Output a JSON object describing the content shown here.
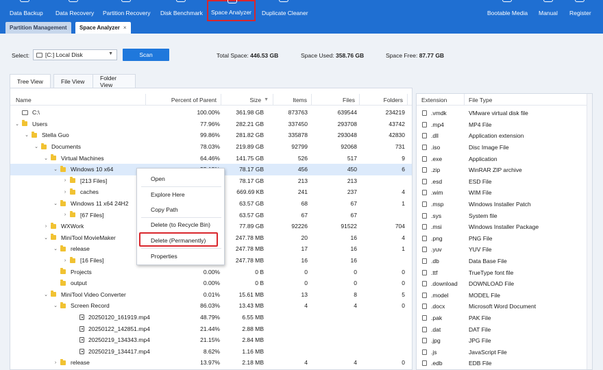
{
  "toolbar": {
    "items": [
      {
        "label": "Data Backup",
        "icon": "backup-icon"
      },
      {
        "label": "Data Recovery",
        "icon": "recovery-icon"
      },
      {
        "label": "Partition Recovery",
        "icon": "partition-recovery-icon"
      },
      {
        "label": "Disk Benchmark",
        "icon": "benchmark-icon"
      },
      {
        "label": "Space Analyzer",
        "icon": "space-analyzer-icon"
      },
      {
        "label": "Duplicate Cleaner",
        "icon": "duplicate-icon"
      },
      {
        "label": "Bootable Media",
        "icon": "bootable-icon"
      },
      {
        "label": "Manual",
        "icon": "manual-icon"
      },
      {
        "label": "Register",
        "icon": "register-icon"
      }
    ],
    "active_item": "Space Analyzer"
  },
  "tabs": [
    {
      "label": "Partition Management"
    },
    {
      "label": "Space Analyzer",
      "close": "×"
    }
  ],
  "controls": {
    "select_label": "Select:",
    "drive_value": "[C:] Local Disk",
    "scan_label": "Scan",
    "total_label": "Total Space:",
    "total_value": "446.53 GB",
    "used_label": "Space Used:",
    "used_value": "358.76 GB",
    "free_label": "Space Free:",
    "free_value": "87.77 GB"
  },
  "view_tabs": [
    "Tree View",
    "File View",
    "Folder View"
  ],
  "tree": {
    "columns": [
      "Name",
      "Percent of Parent",
      "Size",
      "Items",
      "Files",
      "Folders"
    ],
    "rows": [
      {
        "expander": "",
        "icon": "drive",
        "name": "C:\\",
        "pct": "100.00%",
        "size": "361.98 GB",
        "items": "873763",
        "files": "639544",
        "folders": "234219"
      },
      {
        "expander": "⌄",
        "icon": "folder",
        "name": "Users",
        "pct": "77.96%",
        "size": "282.21 GB",
        "items": "337450",
        "files": "293708",
        "folders": "43742"
      },
      {
        "expander": "⌄",
        "icon": "folder",
        "name": "Stella Guo",
        "pct": "99.86%",
        "size": "281.82 GB",
        "items": "335878",
        "files": "293048",
        "folders": "42830"
      },
      {
        "expander": "⌄",
        "icon": "folder",
        "name": "Documents",
        "pct": "78.03%",
        "size": "219.89 GB",
        "items": "92799",
        "files": "92068",
        "folders": "731"
      },
      {
        "expander": "⌄",
        "icon": "folder",
        "name": "Virtual Machines",
        "pct": "64.46%",
        "size": "141.75 GB",
        "items": "526",
        "files": "517",
        "folders": "9"
      },
      {
        "expander": "⌄",
        "icon": "folder",
        "name": "Windows 10 x64",
        "pct": "55.15%",
        "size": "78.17 GB",
        "items": "456",
        "files": "450",
        "folders": "6"
      },
      {
        "expander": "›",
        "icon": "folder",
        "name": "[213 Files]",
        "pct": "",
        "size": "78.17 GB",
        "items": "213",
        "files": "213",
        "folders": ""
      },
      {
        "expander": "›",
        "icon": "folder",
        "name": "caches",
        "pct": "",
        "size": "669.69 KB",
        "items": "241",
        "files": "237",
        "folders": "4"
      },
      {
        "expander": "⌄",
        "icon": "folder",
        "name": "Windows 11 x64 24H2",
        "pct": "",
        "size": "63.57 GB",
        "items": "68",
        "files": "67",
        "folders": "1"
      },
      {
        "expander": "›",
        "icon": "folder",
        "name": "[67 Files]",
        "pct": "",
        "size": "63.57 GB",
        "items": "67",
        "files": "67",
        "folders": ""
      },
      {
        "expander": "›",
        "icon": "folder",
        "name": "WXWork",
        "pct": "",
        "size": "77.89 GB",
        "items": "92226",
        "files": "91522",
        "folders": "704"
      },
      {
        "expander": "⌄",
        "icon": "folder",
        "name": "MiniTool MovieMaker",
        "pct": "",
        "size": "247.78 MB",
        "items": "20",
        "files": "16",
        "folders": "4"
      },
      {
        "expander": "⌄",
        "icon": "folder",
        "name": "release",
        "pct": "",
        "size": "247.78 MB",
        "items": "17",
        "files": "16",
        "folders": "1"
      },
      {
        "expander": "›",
        "icon": "folder",
        "name": "[16 Files]",
        "pct": "",
        "size": "247.78 MB",
        "items": "16",
        "files": "16",
        "folders": ""
      },
      {
        "expander": "",
        "icon": "folder",
        "name": "Projects",
        "pct": "0.00%",
        "size": "0 B",
        "items": "0",
        "files": "0",
        "folders": "0"
      },
      {
        "expander": "",
        "icon": "folder",
        "name": "output",
        "pct": "0.00%",
        "size": "0 B",
        "items": "0",
        "files": "0",
        "folders": "0"
      },
      {
        "expander": "⌄",
        "icon": "folder",
        "name": "MiniTool Video Converter",
        "pct": "0.01%",
        "size": "15.61 MB",
        "items": "13",
        "files": "8",
        "folders": "5"
      },
      {
        "expander": "⌄",
        "icon": "folder",
        "name": "Screen Record",
        "pct": "86.03%",
        "size": "13.43 MB",
        "items": "4",
        "files": "4",
        "folders": "0"
      },
      {
        "expander": "",
        "icon": "file",
        "name": "20250120_161919.mp4",
        "pct": "48.79%",
        "size": "6.55 MB",
        "items": "",
        "files": "",
        "folders": ""
      },
      {
        "expander": "",
        "icon": "file",
        "name": "20250122_142851.mp4",
        "pct": "21.44%",
        "size": "2.88 MB",
        "items": "",
        "files": "",
        "folders": ""
      },
      {
        "expander": "",
        "icon": "file",
        "name": "20250219_134343.mp4",
        "pct": "21.15%",
        "size": "2.84 MB",
        "items": "",
        "files": "",
        "folders": ""
      },
      {
        "expander": "",
        "icon": "file",
        "name": "20250219_134417.mp4",
        "pct": "8.62%",
        "size": "1.16 MB",
        "items": "",
        "files": "",
        "folders": ""
      },
      {
        "expander": "›",
        "icon": "folder",
        "name": "release",
        "pct": "13.97%",
        "size": "2.18 MB",
        "items": "4",
        "files": "4",
        "folders": "0"
      }
    ]
  },
  "extensions": {
    "columns": [
      "Extension",
      "File Type"
    ],
    "rows": [
      {
        "ext": ".vmdk",
        "type": "VMware virtual disk file"
      },
      {
        "ext": ".mp4",
        "type": "MP4 File"
      },
      {
        "ext": ".dll",
        "type": "Application extension"
      },
      {
        "ext": ".iso",
        "type": "Disc Image File"
      },
      {
        "ext": ".exe",
        "type": "Application"
      },
      {
        "ext": ".zip",
        "type": "WinRAR ZIP archive"
      },
      {
        "ext": ".esd",
        "type": "ESD File"
      },
      {
        "ext": ".wim",
        "type": "WIM File"
      },
      {
        "ext": ".msp",
        "type": "Windows Installer Patch"
      },
      {
        "ext": ".sys",
        "type": "System file"
      },
      {
        "ext": ".msi",
        "type": "Windows Installer Package"
      },
      {
        "ext": ".png",
        "type": "PNG File"
      },
      {
        "ext": ".yuv",
        "type": "YUV File"
      },
      {
        "ext": ".db",
        "type": "Data Base File"
      },
      {
        "ext": ".ttf",
        "type": "TrueType font file"
      },
      {
        "ext": ".download",
        "type": "DOWNLOAD File"
      },
      {
        "ext": ".model",
        "type": "MODEL File"
      },
      {
        "ext": ".docx",
        "type": "Microsoft Word Document"
      },
      {
        "ext": ".pak",
        "type": "PAK File"
      },
      {
        "ext": ".dat",
        "type": "DAT File"
      },
      {
        "ext": ".jpg",
        "type": "JPG File"
      },
      {
        "ext": ".js",
        "type": "JavaScript File"
      },
      {
        "ext": ".edb",
        "type": "EDB File"
      }
    ]
  },
  "context_menu": {
    "items": [
      "Open",
      "Explore Here",
      "Copy Path",
      "Delete (to Recycle Bin)",
      "Delete (Permanently)",
      "Properties"
    ],
    "highlighted": "Delete (Permanently)"
  },
  "colors": {
    "toolbar": "#1f6fd2",
    "highlight_box": "#d9262c",
    "scan_button": "#1f78dc",
    "selected_row": "#dceafb"
  }
}
